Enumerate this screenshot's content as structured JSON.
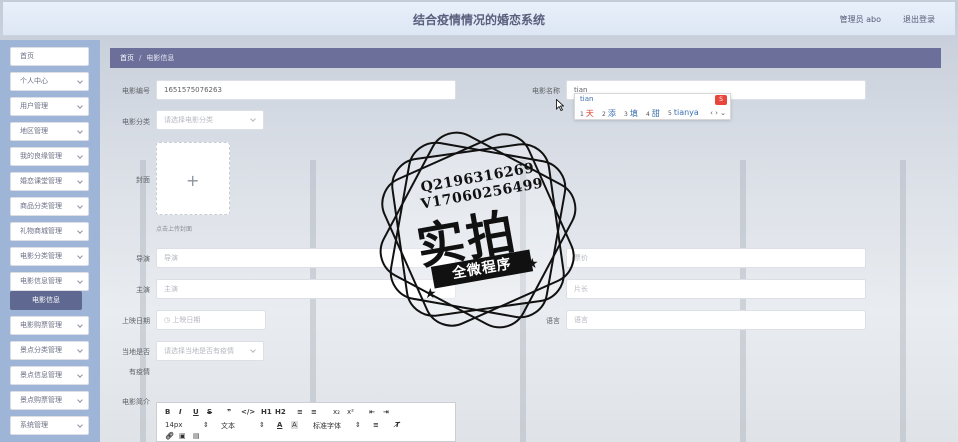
{
  "header": {
    "title": "结合疫情情况的婚恋系统",
    "user": "管理员 abo",
    "logout": "退出登录"
  },
  "sidebar": {
    "items": [
      {
        "label": "首页"
      },
      {
        "label": "个人中心"
      },
      {
        "label": "用户管理"
      },
      {
        "label": "地区管理"
      },
      {
        "label": "我的良缘管理"
      },
      {
        "label": "婚恋课堂管理"
      },
      {
        "label": "商品分类管理"
      },
      {
        "label": "礼物商城管理"
      },
      {
        "label": "电影分类管理"
      },
      {
        "label": "电影信息管理"
      },
      {
        "label": "电影信息"
      },
      {
        "label": "电影购票管理"
      },
      {
        "label": "景点分类管理"
      },
      {
        "label": "景点信息管理"
      },
      {
        "label": "景点购票管理"
      },
      {
        "label": "系统管理"
      }
    ]
  },
  "breadcrumb": {
    "home": "首页",
    "sep": "/",
    "current": "电影信息"
  },
  "form": {
    "movie_no_label": "电影编号",
    "movie_no_value": "1651575076263",
    "movie_name_label": "电影名称",
    "movie_name_value": "tian",
    "category_label": "电影分类",
    "category_placeholder": "请选择电影分类",
    "cover_label": "封面",
    "upload_plus": "+",
    "upload_tip": "点击上传封面",
    "director_label": "导演",
    "director_placeholder": "导演",
    "right_row1_placeholder": "票价",
    "actor_label": "主演",
    "actor_placeholder": "主演",
    "right_row2_placeholder": "片长",
    "release_label": "上映日期",
    "release_placeholder": "上映日期",
    "language_label": "语言",
    "language_placeholder": "语言",
    "epidemic_label": "当地是否",
    "epidemic_label2": "有疫情",
    "epidemic_placeholder": "请选择当地是否有疫情",
    "intro_label": "电影简介"
  },
  "ime": {
    "composition": "tian",
    "candidates": [
      {
        "n": "1",
        "text": "天"
      },
      {
        "n": "2",
        "text": "添"
      },
      {
        "n": "3",
        "text": "填"
      },
      {
        "n": "4",
        "text": "甜"
      },
      {
        "n": "5",
        "text": "tianya"
      }
    ],
    "nav": "‹ › ⌄"
  },
  "editor": {
    "toolbar_row1": [
      "B",
      "I",
      "U",
      "S",
      "❞",
      "</>",
      "H1",
      "H2",
      "≡",
      "≡",
      "x₂",
      "x²",
      "⇤",
      "⇥"
    ],
    "size_value": "14px",
    "format_value": "文本",
    "font_value": "标准字体"
  },
  "watermark": {
    "line1": "Q2196316269",
    "line2": "V17060256499",
    "big": "实拍",
    "ribbon": "全微程序"
  },
  "colors": {
    "sidebar_bg": "#9fb5d8",
    "breadcrumb_bg": "#6b6f9a",
    "active_item_bg": "#5f6890"
  }
}
